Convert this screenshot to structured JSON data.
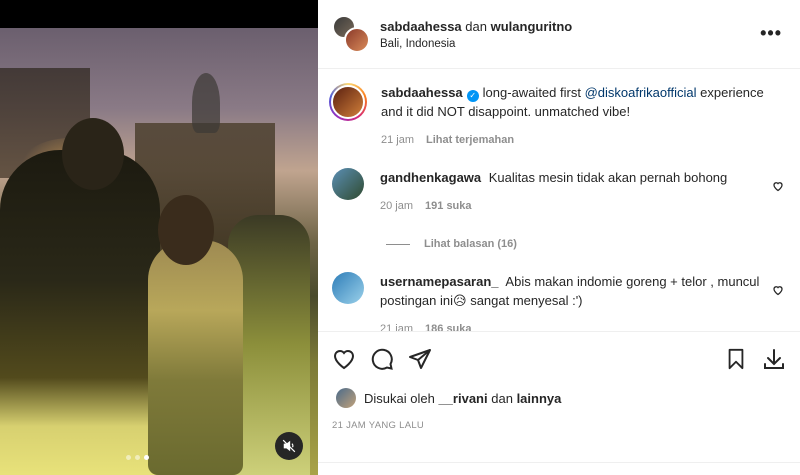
{
  "post": {
    "header": {
      "user1": "sabdaahessa",
      "connector": "dan",
      "user2": "wulanguritno",
      "location": "Bali, Indonesia"
    },
    "caption": {
      "user": "sabdaahessa",
      "text_before": "long-awaited first",
      "mention": "@diskoafrikaofficial",
      "text_after": "experience and it did NOT disappoint. unmatched vibe!",
      "time": "21 jam",
      "translate": "Lihat terjemahan"
    },
    "comments": [
      {
        "user": "gandhenkagawa",
        "text": "Kualitas mesin tidak akan pernah bohong",
        "time": "20 jam",
        "likes": "191 suka",
        "replies_label": "Lihat balasan (16)"
      },
      {
        "user": "usernamepasaran_",
        "text": "Abis makan indomie goreng + telor , muncul postingan ini",
        "emoji": "😥",
        "text_end": "sangat menyesal :')",
        "time": "21 jam",
        "likes": "186 suka"
      }
    ],
    "liked_by": {
      "prefix": "Disukai oleh",
      "user": "__rivani",
      "connector": "dan",
      "others": "lainnya"
    },
    "timestamp": "21 JAM YANG LALU",
    "media": {
      "slide_count": 3,
      "active_slide": 3
    }
  }
}
